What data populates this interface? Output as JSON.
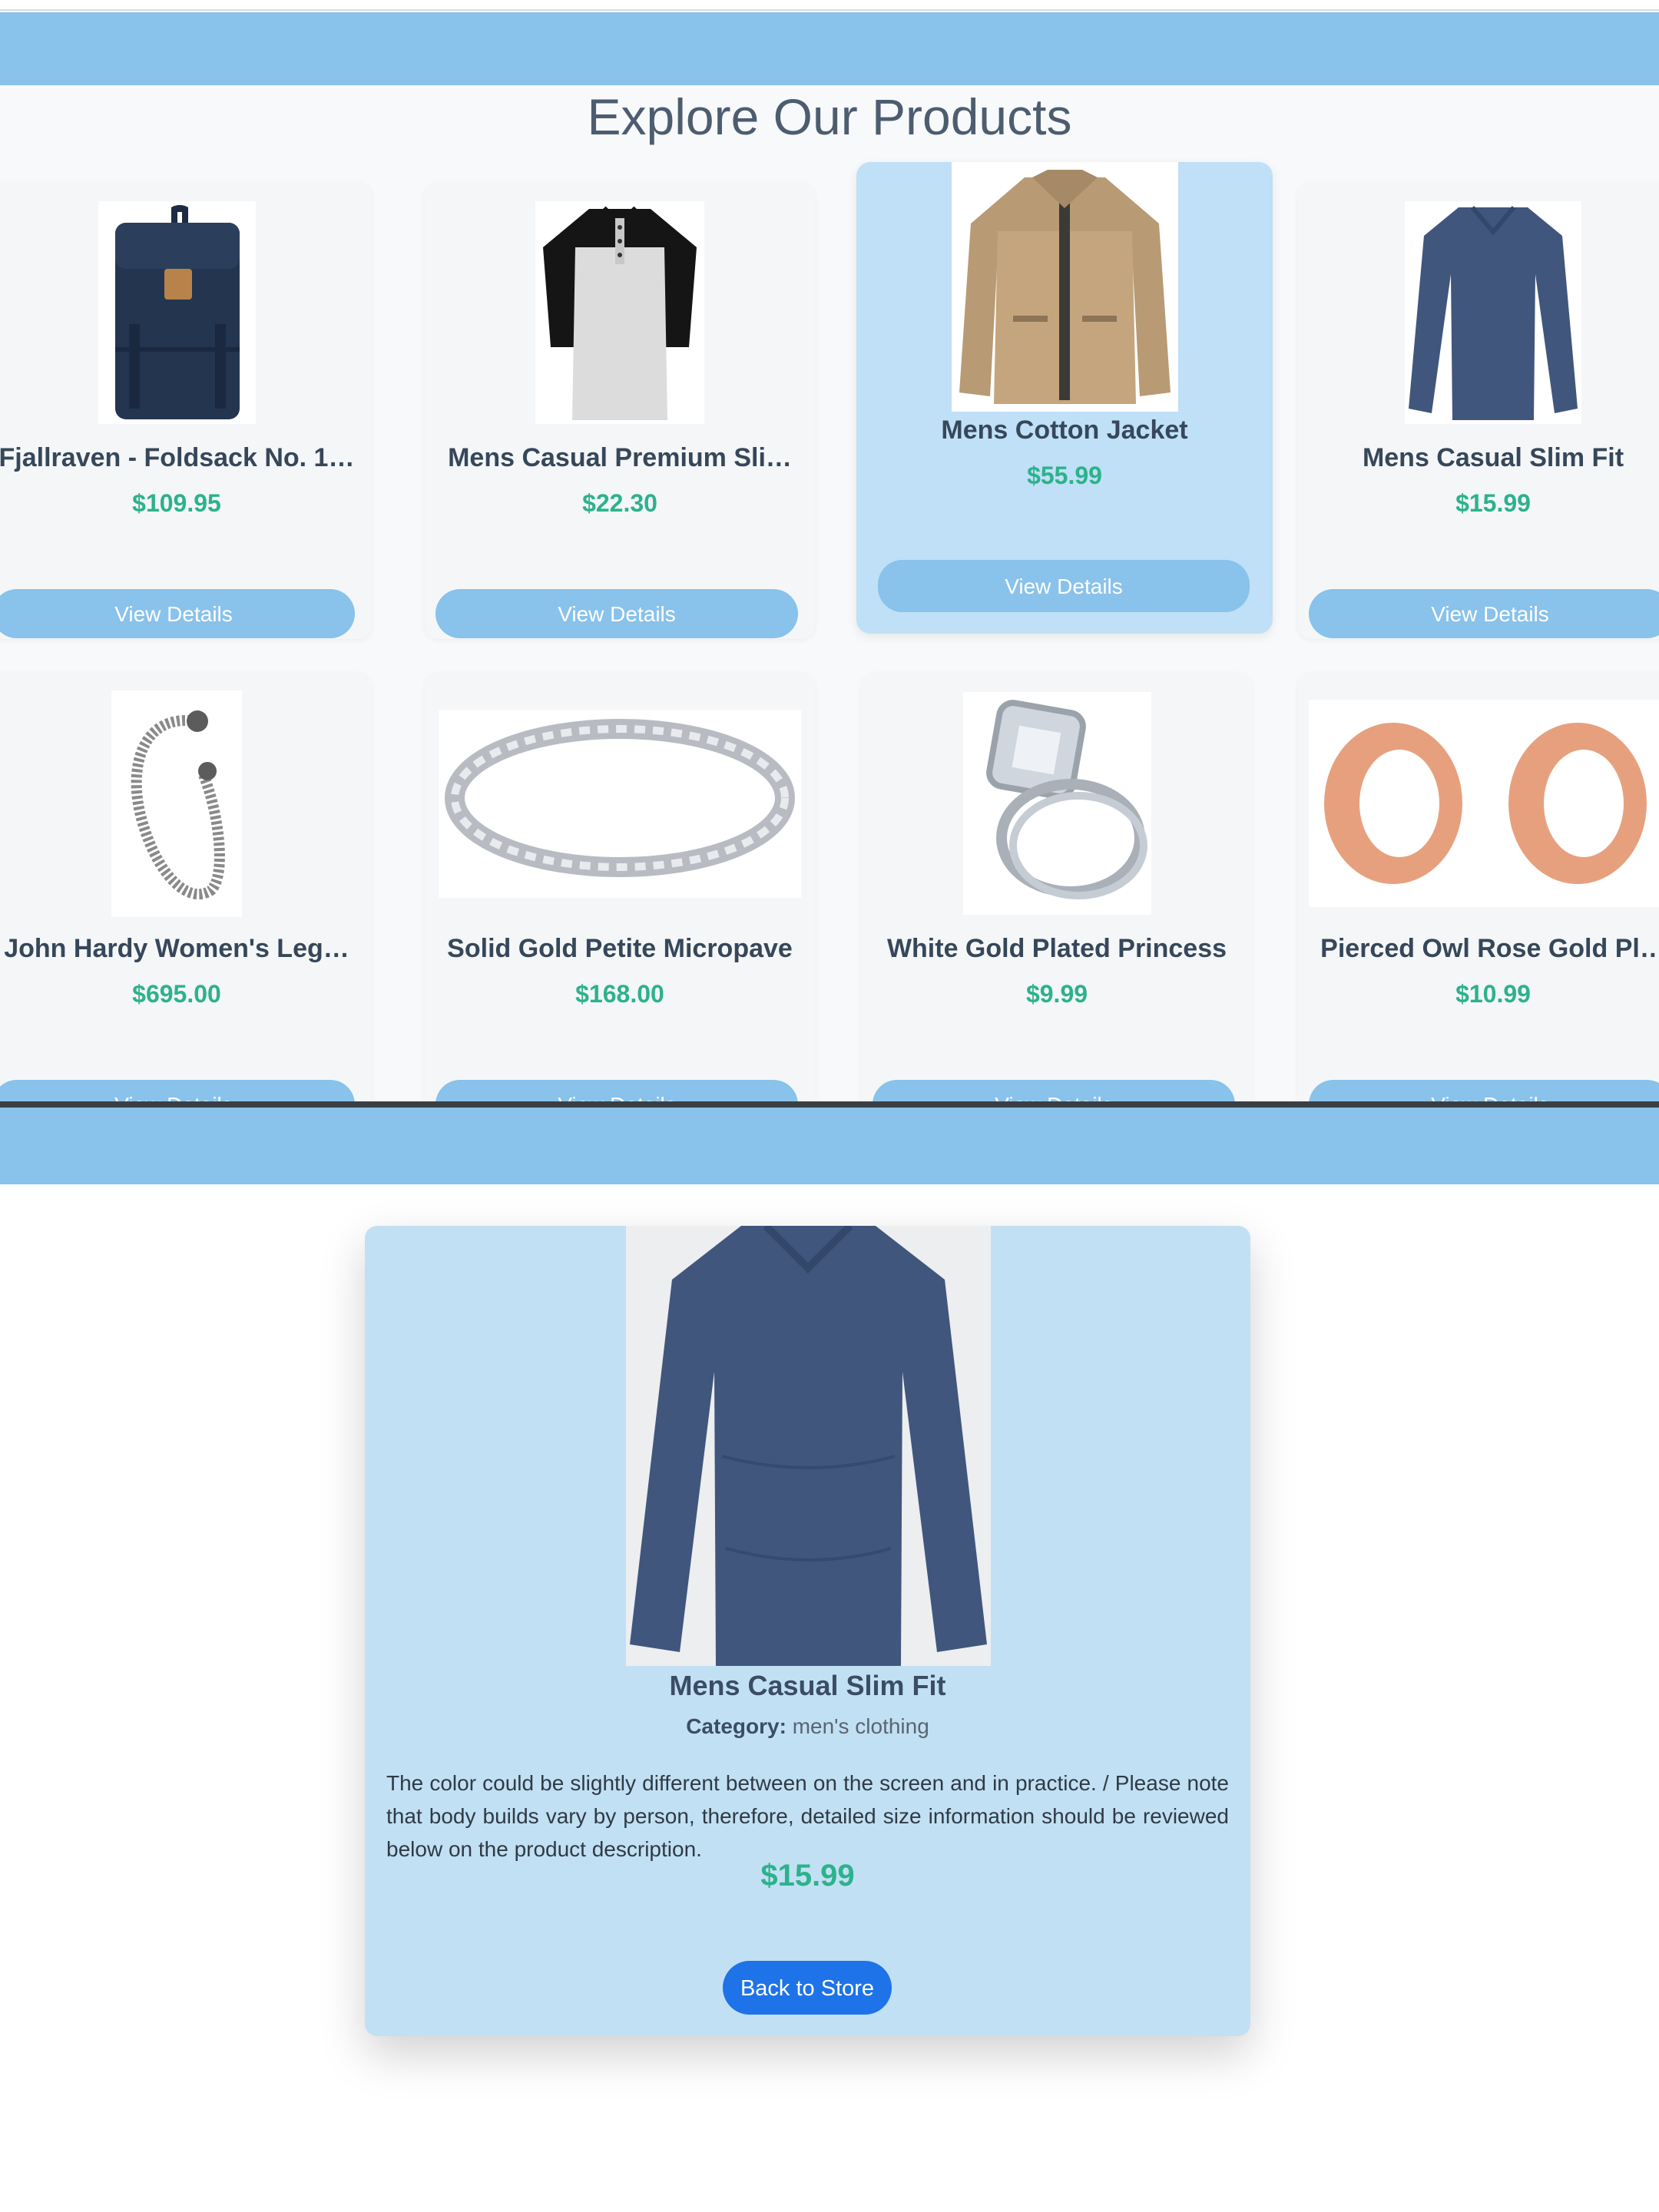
{
  "store": {
    "title": "Explore Our Products",
    "view_label": "View Details",
    "products": [
      {
        "name": "Fjallraven - Foldsack No. 1…",
        "price": "$109.95",
        "image": "backpack"
      },
      {
        "name": "Mens Casual Premium Sli…",
        "price": "$22.30",
        "image": "raglan-tshirt"
      },
      {
        "name": "Mens Cotton Jacket",
        "price": "$55.99",
        "image": "cotton-jacket"
      },
      {
        "name": "Mens Casual Slim Fit",
        "price": "$15.99",
        "image": "long-sleeve-shirt"
      },
      {
        "name": "John Hardy Women's Leg…",
        "price": "$695.00",
        "image": "dragon-bracelet"
      },
      {
        "name": "Solid Gold Petite Micropave",
        "price": "$168.00",
        "image": "micropave-ring"
      },
      {
        "name": "White Gold Plated Princess",
        "price": "$9.99",
        "image": "princess-ring"
      },
      {
        "name": "Pierced Owl Rose Gold Pl…",
        "price": "$10.99",
        "image": "rose-gold-plugs"
      }
    ]
  },
  "detail": {
    "name": "Mens Casual Slim Fit",
    "category_label": "Category:",
    "category": "men's clothing",
    "description": "The color could be slightly different between on the screen and in practice. / Please note that body builds vary by person, therefore, detailed size information should be reviewed below on the product description.",
    "price": "$15.99",
    "back_label": "Back to Store"
  },
  "colors": {
    "header": "#89c2ea",
    "highlight_card": "#bfe0f6",
    "price": "#2db28b",
    "back_button": "#1e73e8"
  }
}
